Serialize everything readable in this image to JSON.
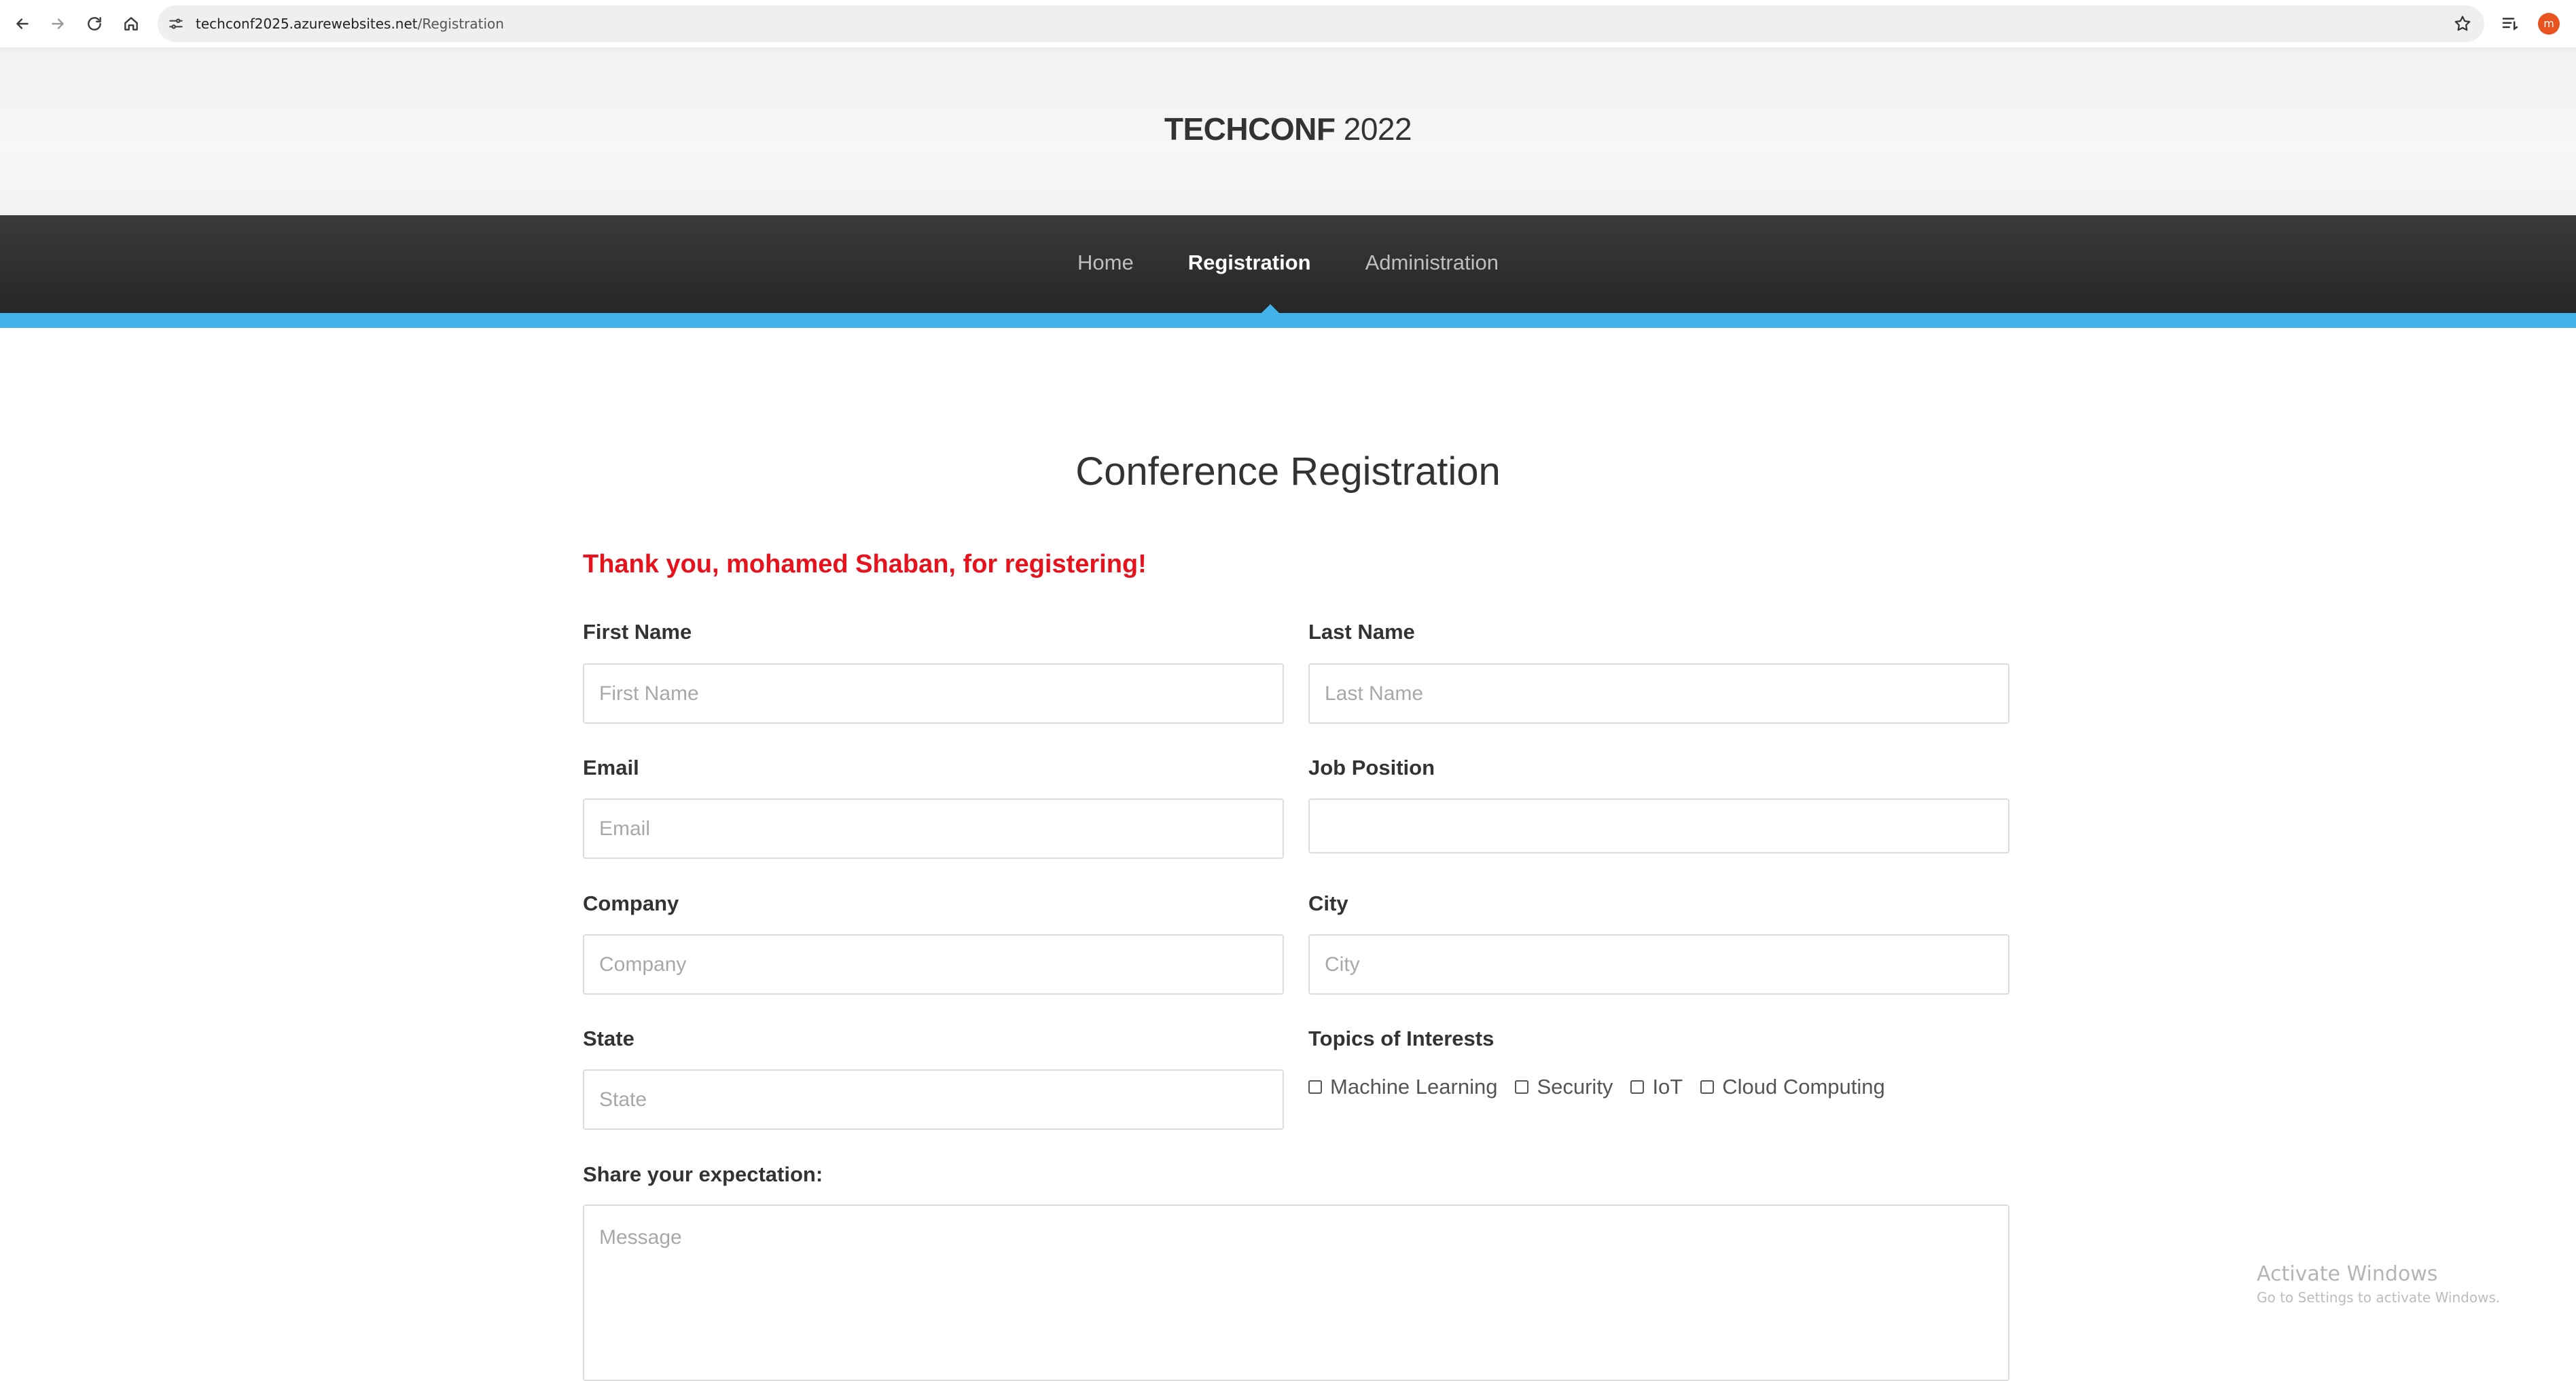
{
  "browser": {
    "url_host": "techconf2025.azurewebsites.net",
    "url_path": "/Registration",
    "profile_initial": "m",
    "icons": [
      "back-icon",
      "forward-icon",
      "reload-icon",
      "home-icon",
      "site-settings-icon",
      "star-icon",
      "tab-search-icon"
    ]
  },
  "header": {
    "brand_bold": "TECHCONF",
    "brand_year": " 2022"
  },
  "nav": {
    "items": [
      {
        "label": "Home",
        "active": false
      },
      {
        "label": "Registration",
        "active": true
      },
      {
        "label": "Administration",
        "active": false
      }
    ]
  },
  "colors": {
    "accent": "#41b3e8",
    "nav_bg": "#2e2e2e",
    "success_text": "#e8121c"
  },
  "form": {
    "title": "Conference Registration",
    "message": "Thank you, mohamed Shaban, for registering!",
    "first_name": {
      "label": "First Name",
      "placeholder": "First Name",
      "value": ""
    },
    "last_name": {
      "label": "Last Name",
      "placeholder": "Last Name",
      "value": ""
    },
    "email": {
      "label": "Email",
      "placeholder": "Email",
      "value": ""
    },
    "job_position": {
      "label": "Job Position",
      "value": ""
    },
    "company": {
      "label": "Company",
      "placeholder": "Company",
      "value": ""
    },
    "city": {
      "label": "City",
      "placeholder": "City",
      "value": ""
    },
    "state": {
      "label": "State",
      "placeholder": "State",
      "value": ""
    },
    "topics": {
      "label": "Topics of Interests",
      "options": [
        {
          "label": "Machine Learning",
          "checked": false
        },
        {
          "label": "Security",
          "checked": false
        },
        {
          "label": "IoT",
          "checked": false
        },
        {
          "label": "Cloud Computing",
          "checked": false
        }
      ]
    },
    "expectation": {
      "label": "Share your expectation:",
      "placeholder": "Message",
      "value": ""
    }
  },
  "watermark": {
    "line1": "Activate Windows",
    "line2": "Go to Settings to activate Windows."
  }
}
